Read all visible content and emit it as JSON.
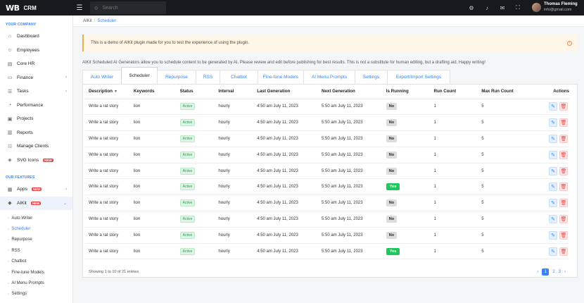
{
  "app": {
    "logo": "WB",
    "name": "CRM"
  },
  "search": {
    "placeholder": "Search"
  },
  "user": {
    "name": "Thomas Fleming",
    "email": "info@gmail.com"
  },
  "sidebar": {
    "section1": "YOUR COMPANY",
    "items": [
      {
        "label": "Dashboard",
        "icon": "home-icon"
      },
      {
        "label": "Employees",
        "icon": "user-icon"
      },
      {
        "label": "Core HR",
        "icon": "id-icon"
      },
      {
        "label": "Finance",
        "icon": "wallet-icon"
      },
      {
        "label": "Tasks",
        "icon": "tasks-icon"
      },
      {
        "label": "Performance",
        "icon": "chart-icon"
      },
      {
        "label": "Projects",
        "icon": "folder-icon"
      },
      {
        "label": "Reports",
        "icon": "report-icon"
      },
      {
        "label": "Manage Clients",
        "icon": "clients-icon"
      },
      {
        "label": "SVG Icons",
        "icon": "svg-icon",
        "badge": "NEW"
      }
    ],
    "section2": "OUR FEATURES",
    "features": [
      {
        "label": "Apps",
        "badge": "NEW"
      },
      {
        "label": "AIKit",
        "badge": "NEW"
      }
    ],
    "sub_items": [
      "Auto Writer",
      "Scheduler",
      "Repurpose",
      "RSS",
      "Chatbot",
      "Fine-tune Models",
      "AI Menu Prompts",
      "Settings"
    ]
  },
  "breadcrumb": {
    "root": "AIKit",
    "sep": "/",
    "current": "Scheduler"
  },
  "notice": "This is a demo of AIKit plugin made for you to test the experience of using the plugin.",
  "description": "AIKit Scheduled AI Generators allow you to schedule content to be generated by AI. Please review and edit before publishing for best results. This is not a substitute for human editing, but a drafting aid. Happy writing!",
  "tabs": [
    "Auto Writer",
    "Scheduler",
    "Repurpose",
    "RSS",
    "Chatbot",
    "Fine-tune Models",
    "AI Menu Prompts",
    "Settings",
    "Export/Import Settings"
  ],
  "table": {
    "headers": [
      "Description",
      "Keywords",
      "Status",
      "Interval",
      "Last Generation",
      "Next Generation",
      "Is Running",
      "Run Count",
      "Max Run Count",
      "Actions"
    ],
    "rows": [
      {
        "description": "Write a rat story",
        "keywords": "lion",
        "status": "Active",
        "interval": "hourly",
        "last": "4:50 am July 11, 2023",
        "next": "5:50 am July 11, 2023",
        "running": "No",
        "run_count": "1",
        "max": "5"
      },
      {
        "description": "Write a rat story",
        "keywords": "lion",
        "status": "Active",
        "interval": "hourly",
        "last": "4:50 am July 11, 2023",
        "next": "5:50 am July 11, 2023",
        "running": "No",
        "run_count": "1",
        "max": "5"
      },
      {
        "description": "Write a rat story",
        "keywords": "lion",
        "status": "Active",
        "interval": "hourly",
        "last": "4:50 am July 11, 2023",
        "next": "5:50 am July 11, 2023",
        "running": "No",
        "run_count": "1",
        "max": "5"
      },
      {
        "description": "Write a rat story",
        "keywords": "lion",
        "status": "Active",
        "interval": "hourly",
        "last": "4:50 am July 11, 2023",
        "next": "5:50 am July 11, 2023",
        "running": "No",
        "run_count": "1",
        "max": "5"
      },
      {
        "description": "Write a rat story",
        "keywords": "lion",
        "status": "Active",
        "interval": "hourly",
        "last": "4:50 am July 11, 2023",
        "next": "5:50 am July 11, 2023",
        "running": "No",
        "run_count": "1",
        "max": "5"
      },
      {
        "description": "Write a rat story",
        "keywords": "lion",
        "status": "Active",
        "interval": "hourly",
        "last": "4:50 am July 11, 2023",
        "next": "5:50 am July 11, 2023",
        "running": "Yes",
        "run_count": "1",
        "max": "5"
      },
      {
        "description": "Write a rat story",
        "keywords": "lion",
        "status": "Active",
        "interval": "hourly",
        "last": "4:50 am July 11, 2023",
        "next": "5:50 am July 11, 2023",
        "running": "No",
        "run_count": "1",
        "max": "5"
      },
      {
        "description": "Write a rat story",
        "keywords": "lion",
        "status": "Active",
        "interval": "hourly",
        "last": "4:50 am July 11, 2023",
        "next": "5:50 am July 11, 2023",
        "running": "No",
        "run_count": "1",
        "max": "5"
      },
      {
        "description": "Write a rat story",
        "keywords": "lion",
        "status": "Active",
        "interval": "hourly",
        "last": "4:50 am July 11, 2023",
        "next": "5:50 am July 11, 2023",
        "running": "No",
        "run_count": "1",
        "max": "5"
      },
      {
        "description": "Write a rat story",
        "keywords": "lion",
        "status": "Active",
        "interval": "hourly",
        "last": "4:50 am July 11, 2023",
        "next": "5:50 am July 11, 2023",
        "running": "Yes",
        "run_count": "1",
        "max": "5"
      }
    ]
  },
  "footer": {
    "entries": "Showing 1 to 10 of 21 entries",
    "pages": [
      "1",
      "2",
      "3"
    ],
    "prev": "‹",
    "next": "›"
  },
  "colors": {
    "accent": "#3b82f6",
    "topbar": "#18191c",
    "yes": "#22c55e",
    "danger": "#ef4444"
  }
}
